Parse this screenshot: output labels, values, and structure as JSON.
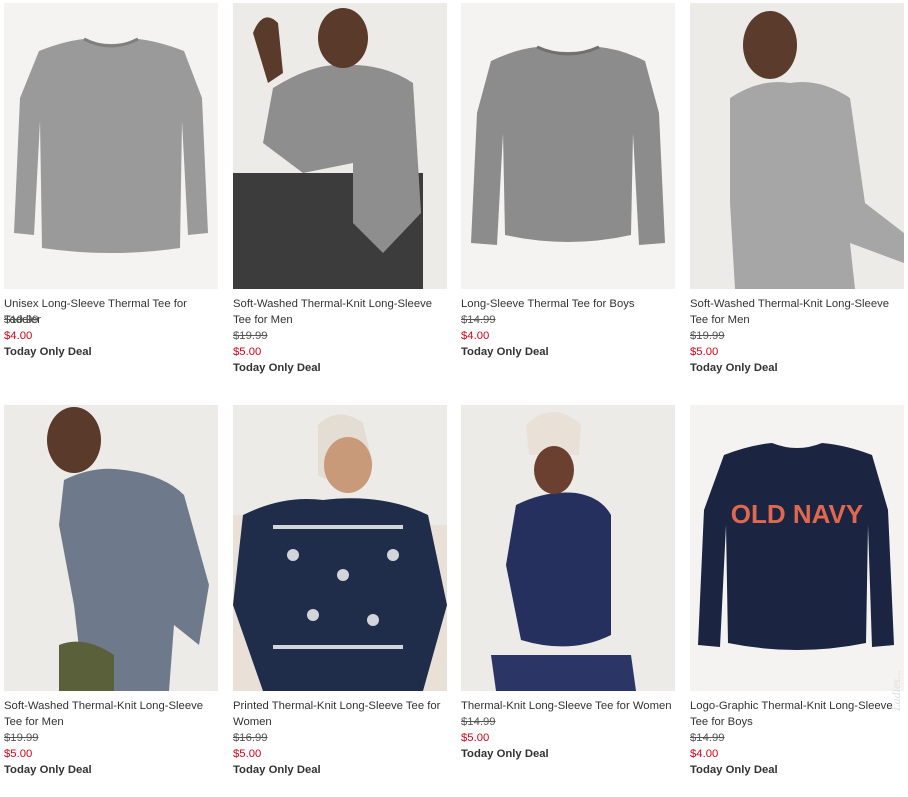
{
  "products": [
    {
      "name": "Unisex Long-Sleeve Thermal Tee for Toddler",
      "original_price": "$10.99",
      "sale_price": "$4.00",
      "deal": "Today Only Deal",
      "image": "gray-thermal-tee-flat",
      "colors": {
        "bg": "#f4f3f1",
        "shirt": "#9a9a9a"
      }
    },
    {
      "name": "Soft-Washed Thermal-Knit Long-Sleeve Tee for Men",
      "original_price": "$19.99",
      "sale_price": "$5.00",
      "deal": "Today Only Deal",
      "image": "man-seated-gray-thermal",
      "colors": {
        "bg": "#ecebe7",
        "shirt": "#8e8e8e"
      }
    },
    {
      "name": "Long-Sleeve Thermal Tee for Boys",
      "original_price": "$14.99",
      "sale_price": "$4.00",
      "deal": "Today Only Deal",
      "image": "gray-thermal-tee-flat",
      "colors": {
        "bg": "#f4f3f1",
        "shirt": "#8c8c8c"
      }
    },
    {
      "name": "Soft-Washed Thermal-Knit Long-Sleeve Tee for Men",
      "original_price": "$19.99",
      "sale_price": "$5.00",
      "deal": "Today Only Deal",
      "image": "man-light-gray-thermal",
      "colors": {
        "bg": "#ecebe7",
        "shirt": "#a6a6a6"
      }
    },
    {
      "name": "Soft-Washed Thermal-Knit Long-Sleeve Tee for Men",
      "original_price": "$19.99",
      "sale_price": "$5.00",
      "deal": "Today Only Deal",
      "image": "man-blue-heather-thermal",
      "colors": {
        "bg": "#ecebe7",
        "shirt": "#6e7a8c"
      }
    },
    {
      "name": "Printed Thermal-Knit Long-Sleeve Tee for Women",
      "original_price": "$16.99",
      "sale_price": "$5.00",
      "deal": "Today Only Deal",
      "image": "woman-fair-isle-thermal",
      "colors": {
        "bg": "#ecebe7",
        "shirt": "#1f2d4a"
      }
    },
    {
      "name": "Thermal-Knit Long-Sleeve Tee for Women",
      "original_price": "$14.99",
      "sale_price": "$5.00",
      "deal": "Today Only Deal",
      "image": "woman-navy-thermal",
      "colors": {
        "bg": "#ecebe7",
        "shirt": "#26305f"
      }
    },
    {
      "name": "Logo-Graphic Thermal-Knit Long-Sleeve Tee for Boys",
      "original_price": "$14.99",
      "sale_price": "$4.00",
      "deal": "Today Only Deal",
      "image": "navy-logo-tee-flat",
      "logo_text": "OLD NAVY",
      "colors": {
        "bg": "#f4f3f1",
        "shirt": "#1b2440",
        "logo": "#e0684e"
      }
    }
  ],
  "watermark": "Ladies..."
}
